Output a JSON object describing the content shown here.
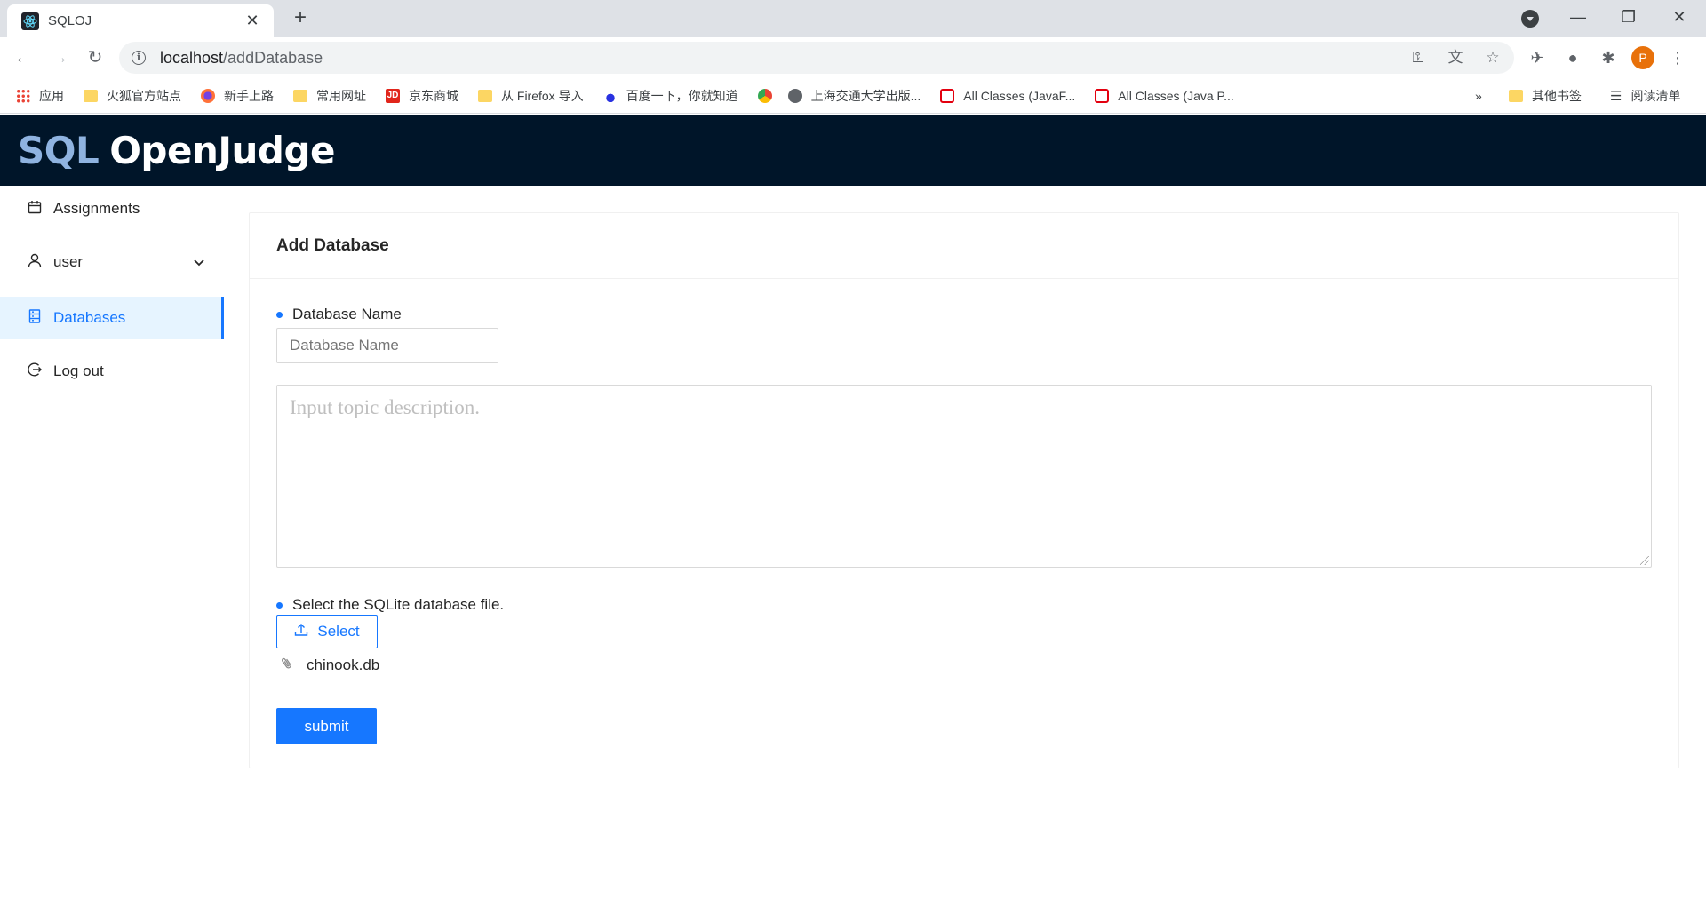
{
  "browser": {
    "tab_title": "SQLOJ",
    "new_tab": "+",
    "url_host": "localhost",
    "url_path": "/addDatabase",
    "profile_initial": "P",
    "bookmarks": [
      {
        "label": "应用",
        "kind": "apps"
      },
      {
        "label": "火狐官方站点",
        "kind": "folder"
      },
      {
        "label": "新手上路",
        "kind": "firefox"
      },
      {
        "label": "常用网址",
        "kind": "folder"
      },
      {
        "label": "京东商城",
        "kind": "jd"
      },
      {
        "label": "从 Firefox 导入",
        "kind": "folder"
      },
      {
        "label": "百度一下，你就知道",
        "kind": "baidu"
      },
      {
        "label": "",
        "kind": "chrome"
      },
      {
        "label": "上海交通大学出版...",
        "kind": "globe"
      },
      {
        "label": "All Classes (JavaF...",
        "kind": "oracle"
      },
      {
        "label": "All Classes (Java P...",
        "kind": "oracle"
      }
    ],
    "bookmarks_overflow": "»",
    "other_bookmarks": "其他书签",
    "reading_list": "阅读清单"
  },
  "app": {
    "logo_sql": "SQL",
    "logo_rest": "OpenJudge"
  },
  "sidebar": {
    "items": [
      {
        "label": "Assignments",
        "icon": "calendar-icon"
      },
      {
        "label": "user",
        "icon": "user-icon"
      },
      {
        "label": "Databases",
        "icon": "database-icon",
        "active": true
      },
      {
        "label": "Log out",
        "icon": "logout-icon"
      }
    ]
  },
  "form": {
    "title": "Add Database",
    "name_label": "Database Name",
    "name_placeholder": "Database Name",
    "description_placeholder": "Input topic description.",
    "file_label": "Select the SQLite database file.",
    "select_button": "Select",
    "file_name": "chinook.db",
    "submit_button": "submit"
  },
  "colors": {
    "primary": "#1677ff",
    "header_bg": "#001529"
  }
}
